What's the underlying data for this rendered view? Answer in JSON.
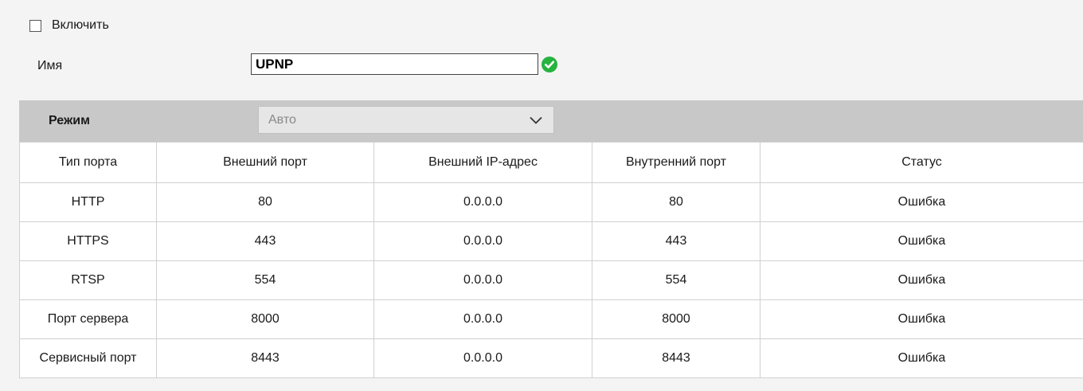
{
  "enable": {
    "label": "Включить",
    "checked": false
  },
  "name": {
    "label": "Имя",
    "value": "UPNP",
    "valid_icon": "check-circle-icon",
    "valid_color": "#26b33f"
  },
  "mode": {
    "label": "Режим",
    "selected": "Авто"
  },
  "table": {
    "columns": [
      "Тип порта",
      "Внешний порт",
      "Внешний IP-адрес",
      "Внутренний порт",
      "Статус"
    ],
    "rows": [
      [
        "HTTP",
        "80",
        "0.0.0.0",
        "80",
        "Ошибка"
      ],
      [
        "HTTPS",
        "443",
        "0.0.0.0",
        "443",
        "Ошибка"
      ],
      [
        "RTSP",
        "554",
        "0.0.0.0",
        "554",
        "Ошибка"
      ],
      [
        "Порт сервера",
        "8000",
        "0.0.0.0",
        "8000",
        "Ошибка"
      ],
      [
        "Сервисный порт",
        "8443",
        "0.0.0.0",
        "8443",
        "Ошибка"
      ]
    ]
  }
}
